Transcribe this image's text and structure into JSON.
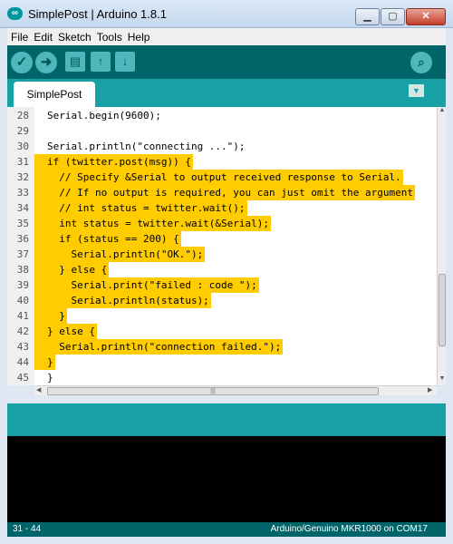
{
  "window": {
    "title": "SimplePost | Arduino 1.8.1"
  },
  "menu": [
    "File",
    "Edit",
    "Sketch",
    "Tools",
    "Help"
  ],
  "tabs": [
    {
      "label": "SimplePost"
    }
  ],
  "editor": {
    "lines": [
      {
        "n": "28",
        "text": "Serial.begin(9600);",
        "hl": false
      },
      {
        "n": "29",
        "text": "",
        "hl": false
      },
      {
        "n": "30",
        "text": "Serial.println(\"connecting ...\");",
        "hl": false
      },
      {
        "n": "31",
        "text": "if (twitter.post(msg)) {",
        "hl": true
      },
      {
        "n": "32",
        "text": "  // Specify &Serial to output received response to Serial.",
        "hl": true
      },
      {
        "n": "33",
        "text": "  // If no output is required, you can just omit the argument",
        "hl": true
      },
      {
        "n": "34",
        "text": "  // int status = twitter.wait();",
        "hl": true
      },
      {
        "n": "35",
        "text": "  int status = twitter.wait(&Serial);",
        "hl": true
      },
      {
        "n": "36",
        "text": "  if (status == 200) {",
        "hl": true
      },
      {
        "n": "37",
        "text": "    Serial.println(\"OK.\");",
        "hl": true
      },
      {
        "n": "38",
        "text": "  } else {",
        "hl": true
      },
      {
        "n": "39",
        "text": "    Serial.print(\"failed : code \");",
        "hl": true
      },
      {
        "n": "40",
        "text": "    Serial.println(status);",
        "hl": true
      },
      {
        "n": "41",
        "text": "  }",
        "hl": true
      },
      {
        "n": "42",
        "text": "} else {",
        "hl": true
      },
      {
        "n": "43",
        "text": "  Serial.println(\"connection failed.\");",
        "hl": true
      },
      {
        "n": "44",
        "text": "}",
        "hl": true
      },
      {
        "n": "45",
        "text": "}",
        "hl": false
      }
    ]
  },
  "status": {
    "cursor": "31 - 44",
    "board": "Arduino/Genuino MKR1000 on COM17"
  },
  "colors": {
    "toolbar": "#006468",
    "tabbar": "#17a1a5",
    "highlight": "#ffcc00",
    "console": "#000000"
  },
  "icons": [
    "arduino-logo-icon",
    "verify-icon",
    "upload-icon",
    "new-icon",
    "open-icon",
    "save-icon",
    "serial-monitor-icon",
    "tab-menu-icon"
  ]
}
